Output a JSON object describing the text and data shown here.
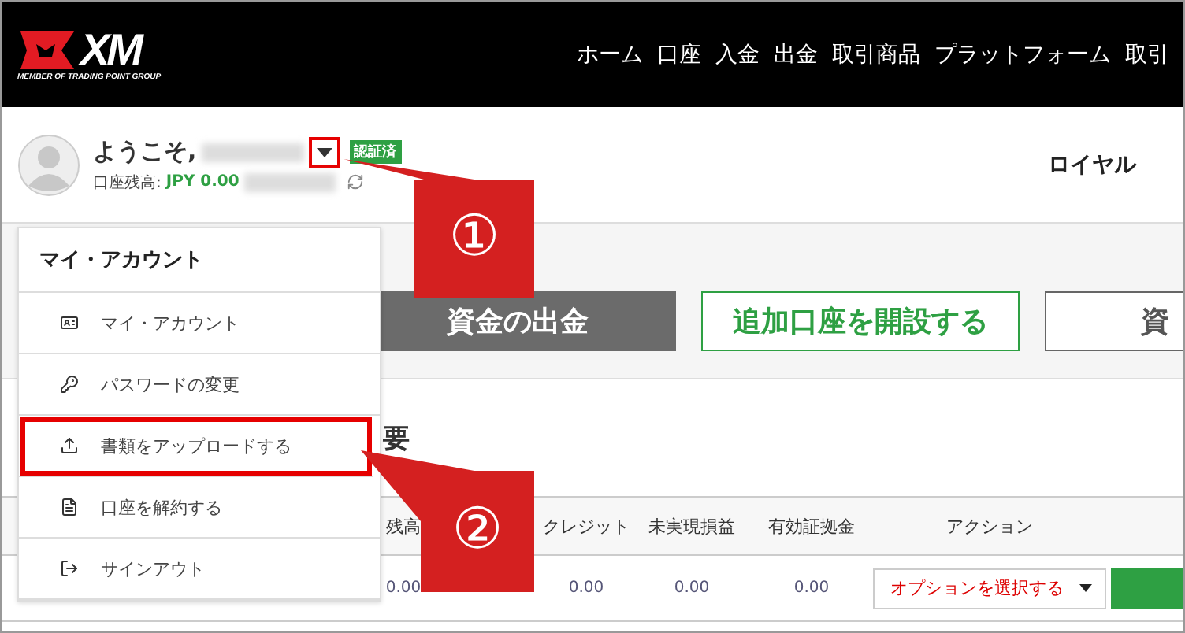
{
  "logo": {
    "mark": "XM",
    "tagline": "MEMBER OF TRADING POINT GROUP"
  },
  "nav": [
    "ホーム",
    "口座",
    "入金",
    "出金",
    "取引商品",
    "プラットフォーム",
    "取引"
  ],
  "user": {
    "greeting": "ようこそ,",
    "caret_highlighted": true,
    "badge": "認証済",
    "balance_label": "口座残高:",
    "balance": "JPY 0.00",
    "loyalty": "ロイヤル"
  },
  "actions": [
    {
      "label": "資金の出金",
      "kind": "dark"
    },
    {
      "label": "追加口座を開設する",
      "kind": "outline-green"
    },
    {
      "label": "資",
      "kind": "outline-grey"
    }
  ],
  "section_heading": "要",
  "table": {
    "columns": [
      "残高",
      "クレジット",
      "未実現損益",
      "有効証拠金",
      "アクション"
    ],
    "rows": [
      {
        "cells": [
          "0.00",
          "0.00",
          "0.00",
          "0.00"
        ],
        "select": "オプションを選択する"
      }
    ]
  },
  "menu": {
    "title": "マイ・アカウント",
    "items": [
      {
        "label": "マイ・アカウント",
        "highlighted": false
      },
      {
        "label": "パスワードの変更",
        "highlighted": false
      },
      {
        "label": "書類をアップロードする",
        "highlighted": true
      },
      {
        "label": "口座を解約する",
        "highlighted": false
      },
      {
        "label": "サインアウト",
        "highlighted": false
      }
    ]
  },
  "callouts": [
    {
      "label": "①"
    },
    {
      "label": "②"
    }
  ]
}
